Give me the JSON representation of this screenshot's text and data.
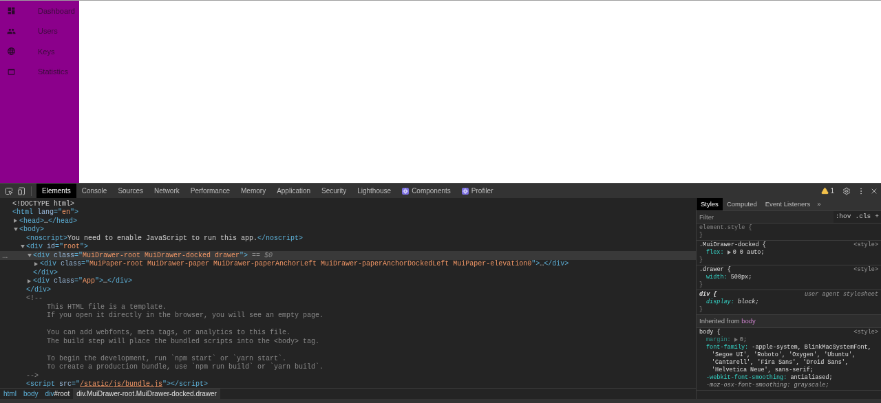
{
  "app": {
    "nav_items": [
      {
        "label": "Dashboard"
      },
      {
        "label": "Users"
      },
      {
        "label": "Keys"
      },
      {
        "label": "Statistics"
      }
    ]
  },
  "devtools": {
    "tabs": [
      {
        "label": "Elements",
        "selected": true,
        "kind": "plain"
      },
      {
        "label": "Console",
        "selected": false,
        "kind": "plain"
      },
      {
        "label": "Sources",
        "selected": false,
        "kind": "plain"
      },
      {
        "label": "Network",
        "selected": false,
        "kind": "plain"
      },
      {
        "label": "Performance",
        "selected": false,
        "kind": "plain"
      },
      {
        "label": "Memory",
        "selected": false,
        "kind": "plain"
      },
      {
        "label": "Application",
        "selected": false,
        "kind": "plain"
      },
      {
        "label": "Security",
        "selected": false,
        "kind": "plain"
      },
      {
        "label": "Lighthouse",
        "selected": false,
        "kind": "plain"
      },
      {
        "label": "Components",
        "selected": false,
        "kind": "react"
      },
      {
        "label": "Profiler",
        "selected": false,
        "kind": "react"
      }
    ],
    "warning_count": "1",
    "dom_tree": [
      {
        "segments": [
          {
            "kind": "doctype",
            "text": "<!DOCTYPE html>"
          }
        ],
        "selected": false
      },
      {
        "segments": [
          {
            "kind": "tag",
            "text": "<html "
          },
          {
            "kind": "attr",
            "text": "lang"
          },
          {
            "kind": "tag",
            "text": "=\""
          },
          {
            "kind": "value",
            "text": "en"
          },
          {
            "kind": "tag",
            "text": "\">"
          }
        ],
        "selected": false,
        "children": [
          {
            "segments": [
              {
                "kind": "tag",
                "text": "<head>"
              },
              {
                "kind": "text",
                "text": "…"
              },
              {
                "kind": "tag",
                "text": "</head>"
              }
            ],
            "expanded": false,
            "selected": false
          },
          {
            "segments": [
              {
                "kind": "tag",
                "text": "<body>"
              }
            ],
            "expanded": true,
            "selected": false,
            "children": [
              {
                "segments": [
                  {
                    "kind": "tag",
                    "text": "<noscript>"
                  },
                  {
                    "kind": "text",
                    "text": "You need to enable JavaScript to run this app."
                  },
                  {
                    "kind": "tag",
                    "text": "</noscript>"
                  }
                ],
                "selected": false
              },
              {
                "segments": [
                  {
                    "kind": "tag",
                    "text": "<div "
                  },
                  {
                    "kind": "attr",
                    "text": "id"
                  },
                  {
                    "kind": "tag",
                    "text": "=\""
                  },
                  {
                    "kind": "value",
                    "text": "root"
                  },
                  {
                    "kind": "tag",
                    "text": "\">"
                  }
                ],
                "expanded": true,
                "selected": false,
                "children": [
                  {
                    "gutter": "...",
                    "segments": [
                      {
                        "kind": "tag",
                        "text": "<div "
                      },
                      {
                        "kind": "attr",
                        "text": "class"
                      },
                      {
                        "kind": "tag",
                        "text": "=\""
                      },
                      {
                        "kind": "value",
                        "text": "MuiDrawer-root MuiDrawer-docked drawer"
                      },
                      {
                        "kind": "tag",
                        "text": "\">"
                      },
                      {
                        "kind": "hint",
                        "text": " == $0"
                      }
                    ],
                    "expanded": true,
                    "selected": true,
                    "children": [
                      {
                        "segments": [
                          {
                            "kind": "tag",
                            "text": "<div "
                          },
                          {
                            "kind": "attr",
                            "text": "class"
                          },
                          {
                            "kind": "tag",
                            "text": "=\""
                          },
                          {
                            "kind": "value",
                            "text": "MuiPaper-root MuiDrawer-paper MuiDrawer-paperAnchorLeft MuiDrawer-paperAnchorDockedLeft MuiPaper-elevation0"
                          },
                          {
                            "kind": "tag",
                            "text": "\">"
                          },
                          {
                            "kind": "text",
                            "text": "…"
                          },
                          {
                            "kind": "tag",
                            "text": "</div>"
                          }
                        ],
                        "expanded": false,
                        "selected": false
                      }
                    ]
                  },
                  {
                    "segments": [
                      {
                        "kind": "tag",
                        "text": "</div>"
                      }
                    ],
                    "selected": false
                  },
                  {
                    "segments": [
                      {
                        "kind": "tag",
                        "text": "<div "
                      },
                      {
                        "kind": "attr",
                        "text": "class"
                      },
                      {
                        "kind": "tag",
                        "text": "=\""
                      },
                      {
                        "kind": "value",
                        "text": "App"
                      },
                      {
                        "kind": "tag",
                        "text": "\">"
                      },
                      {
                        "kind": "text",
                        "text": "…"
                      },
                      {
                        "kind": "tag",
                        "text": "</div>"
                      }
                    ],
                    "expanded": false,
                    "selected": false
                  }
                ]
              },
              {
                "segments": [
                  {
                    "kind": "tag",
                    "text": "</div>"
                  }
                ],
                "selected": false
              },
              {
                "segments": [
                  {
                    "kind": "comment",
                    "text": "<!--"
                  }
                ],
                "selected": false,
                "children": [
                  {
                    "segments": [
                      {
                        "kind": "comment",
                        "text": "This HTML file is a template."
                      }
                    ],
                    "selected": false
                  },
                  {
                    "segments": [
                      {
                        "kind": "comment",
                        "text": "If you open it directly in the browser, you will see an empty page."
                      }
                    ],
                    "selected": false
                  },
                  {
                    "gap_before": true,
                    "segments": [
                      {
                        "kind": "comment",
                        "text": "You can add webfonts, meta tags, or analytics to this file."
                      }
                    ],
                    "selected": false
                  },
                  {
                    "segments": [
                      {
                        "kind": "comment",
                        "text": "The build step will place the bundled scripts into the <body> tag."
                      }
                    ],
                    "selected": false
                  },
                  {
                    "gap_before": true,
                    "segments": [
                      {
                        "kind": "comment",
                        "text": "To begin the development, run `npm start` or `yarn start`."
                      }
                    ],
                    "selected": false
                  },
                  {
                    "segments": [
                      {
                        "kind": "comment",
                        "text": "To create a production bundle, use `npm run build` or `yarn build`."
                      }
                    ],
                    "selected": false
                  }
                ]
              },
              {
                "segments": [
                  {
                    "kind": "comment",
                    "text": "-->"
                  }
                ],
                "selected": false
              },
              {
                "segments": [
                  {
                    "kind": "tag",
                    "text": "<script "
                  },
                  {
                    "kind": "attr",
                    "text": "src"
                  },
                  {
                    "kind": "tag",
                    "text": "=\""
                  },
                  {
                    "kind": "link",
                    "text": "/static/js/bundle.js"
                  },
                  {
                    "kind": "tag",
                    "text": "\"></script>"
                  }
                ],
                "selected": false
              }
            ]
          }
        ]
      }
    ],
    "breadcrumbs": [
      {
        "tag": "html",
        "selected": false
      },
      {
        "tag": "body",
        "selected": false
      },
      {
        "tag": "div",
        "suffix": "#root",
        "selected": false
      },
      {
        "tag": "div.MuiDrawer-root.MuiDrawer-docked.drawer",
        "selected": true
      }
    ],
    "styles_tabs": [
      {
        "label": "Styles",
        "selected": true
      },
      {
        "label": "Computed",
        "selected": false
      },
      {
        "label": "Event Listeners",
        "selected": false
      }
    ],
    "styles_more": "»",
    "filter": {
      "placeholder": "Filter"
    },
    "filter_buttons": [
      ":hov",
      ".cls",
      "+"
    ],
    "rules": [
      {
        "selector": "element.style {",
        "close": "}",
        "kind": "inline"
      },
      {
        "selector": ".MuiDrawer-docked {",
        "close": "}",
        "source": "<style>",
        "kind": "author",
        "declarations": [
          {
            "property": "flex:",
            "value": "0 0 auto;",
            "shorthand": true,
            "inactive": false,
            "overridden": false
          }
        ]
      },
      {
        "selector": ".drawer {",
        "close": "}",
        "source": "<style>",
        "kind": "author",
        "declarations": [
          {
            "property": "width:",
            "value": "500px;",
            "shorthand": false,
            "inactive": false,
            "overridden": false
          }
        ]
      },
      {
        "selector": "div {",
        "close": "}",
        "source": "user agent stylesheet",
        "kind": "ua",
        "declarations": [
          {
            "property": "display:",
            "value": "block;",
            "shorthand": false,
            "inactive": false,
            "overridden": false
          }
        ]
      },
      {
        "inherited_from": "Inherited from",
        "inherited_element": "body",
        "selector": "body {",
        "source": "<style>",
        "kind": "author",
        "declarations": [
          {
            "property": "margin:",
            "value": "0;",
            "shorthand": true,
            "inactive": true,
            "overridden": false
          },
          {
            "property": "font-family:",
            "value": "-apple-system, BlinkMacSystemFont, 'Segoe UI', 'Roboto', 'Oxygen', 'Ubuntu', 'Cantarell', 'Fira Sans', 'Droid Sans', 'Helvetica Neue', sans-serif;",
            "shorthand": false,
            "inactive": false,
            "overridden": false
          },
          {
            "property": "-webkit-font-smoothing:",
            "value": "antialiased;",
            "shorthand": false,
            "inactive": false,
            "overridden": false
          },
          {
            "property": "-moz-osx-font-smoothing:",
            "value": "grayscale;",
            "shorthand": false,
            "inactive": false,
            "overridden": true
          }
        ]
      }
    ]
  }
}
